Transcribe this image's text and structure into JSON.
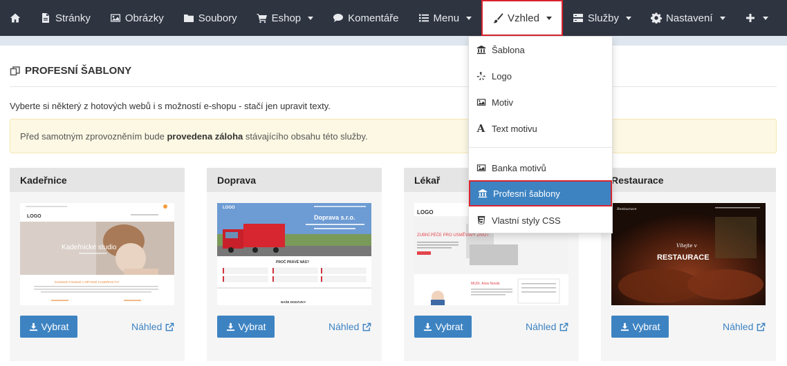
{
  "nav": {
    "home_icon": "home-icon",
    "items": [
      {
        "label": "Stránky",
        "icon": "file-icon"
      },
      {
        "label": "Obrázky",
        "icon": "image-icon"
      },
      {
        "label": "Soubory",
        "icon": "folder-icon"
      },
      {
        "label": "Eshop",
        "icon": "cart-icon"
      },
      {
        "label": "Komentáře",
        "icon": "comments-icon"
      },
      {
        "label": "Menu",
        "icon": "list-icon"
      },
      {
        "label": "Vzhled",
        "icon": "brush-icon"
      },
      {
        "label": "Služby",
        "icon": "services-icon"
      },
      {
        "label": "Nastavení",
        "icon": "gear-icon"
      },
      {
        "label": "",
        "icon": "plus-icon"
      }
    ]
  },
  "dropdown": {
    "items": [
      {
        "label": "Šablona",
        "icon": "bank-icon"
      },
      {
        "label": "Logo",
        "icon": "yelp-icon"
      },
      {
        "label": "Motiv",
        "icon": "picture-icon"
      },
      {
        "label": "Text motivu",
        "icon": "font-icon",
        "glyph": "A"
      },
      {
        "label": "Banka motivů",
        "icon": "picture-icon"
      },
      {
        "label": "Profesní šablony",
        "icon": "bank-icon"
      },
      {
        "label": "Vlastní styly CSS",
        "icon": "css3-icon"
      }
    ]
  },
  "page": {
    "title": "PROFESNÍ ŠABLONY",
    "intro": "Vyberte si některý z hotových webů i s možností e-shopu - stačí jen upravit texty.",
    "alert_before": "Před samotným zprovozněním bude ",
    "alert_bold": "provedena záloha",
    "alert_after": " stávajícího obsahu této služby."
  },
  "cards": [
    {
      "title": "Kadeřnice",
      "select_label": "Vybrat",
      "preview_label": "Náhled",
      "thumb": {
        "logo": "LOGO",
        "hero": "Kadeřnické studio",
        "subtitle": "DÁMSKÉ PÁNSKÉ A DĚTSKÉ KADEŘNICTVÍ"
      }
    },
    {
      "title": "Doprava",
      "select_label": "Vybrat",
      "preview_label": "Náhled",
      "thumb": {
        "logo": "LOGO",
        "hero": "Doprava s.r.o.",
        "subtitle": "PROČ PRÁVĚ NÁS?",
        "footer": "NAŠE DODÁVKY"
      }
    },
    {
      "title": "Lékař",
      "select_label": "Vybrat",
      "preview_label": "Náhled",
      "thumb": {
        "logo": "LOGO",
        "hero": "ZUBNÍ PÉČE PRO USMĚVAVÝ ŽIVOT",
        "subtitle": "MUDr. Alois Novák"
      }
    },
    {
      "title": "Restaurace",
      "select_label": "Vybrat",
      "preview_label": "Náhled",
      "thumb": {
        "logo": "Restaurace",
        "hero_small": "Vítejte v",
        "hero": "RESTAURACE"
      }
    }
  ]
}
